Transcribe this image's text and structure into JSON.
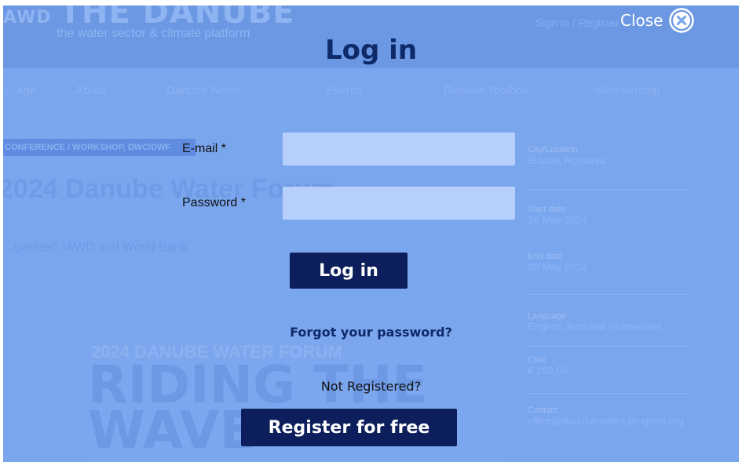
{
  "background": {
    "logo_prefix": "AWD",
    "logo": "THE DANUBE",
    "tagline": "the water sector & climate platform",
    "top_right": "Sign in / Register",
    "nav": [
      "…age",
      "About",
      "Danube News",
      "Events",
      "Danube Toolbox",
      "Membership"
    ],
    "category": "CONFERENCE / WORKSHOP, DWC/DWF",
    "event_title": "2024 Danube Water Forum",
    "organizer": "…ganizer: IAWD and World Bank",
    "sidebar": [
      {
        "label": "City/Location",
        "value": "Brasov, Romania"
      },
      {
        "label": "Start date",
        "value": "28 May 2024"
      },
      {
        "label": "End date",
        "value": "30 May 2024"
      },
      {
        "label": "Language",
        "value": "English, Română (Romanian)"
      },
      {
        "label": "Cost",
        "value": "€ 260.00"
      },
      {
        "label": "Contact",
        "value": "office@danube-water-program.org"
      }
    ],
    "poster_line1": "2024 DANUBE WATER FORUM",
    "poster_line2": "RIDING THE WAVE"
  },
  "modal": {
    "title": "Log in",
    "close_label": "Close",
    "email_label": "E-mail *",
    "email_value": "",
    "password_label": "Password *",
    "password_value": "",
    "login_button": "Log in",
    "forgot_link": "Forgot your password?",
    "not_registered": "Not Registered?",
    "register_button": "Register for free"
  },
  "colors": {
    "overlay": "#7aa6ee",
    "primary": "#0c1f5c",
    "title": "#0e2a68",
    "input_bg": "#b6d0fb"
  },
  "icons": {
    "close": "close-circle-icon"
  }
}
